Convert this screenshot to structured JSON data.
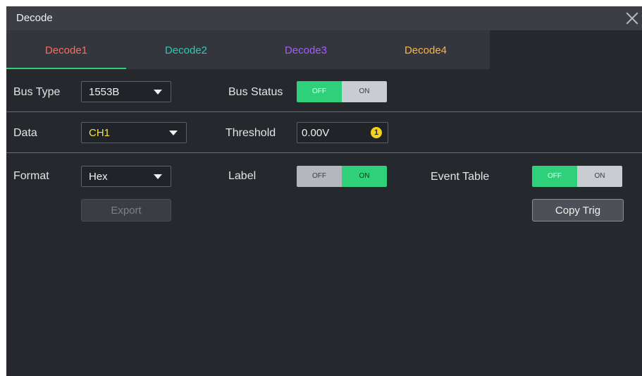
{
  "dialog": {
    "title": "Decode"
  },
  "tabs": [
    {
      "label": "Decode1",
      "color": "#ff6a5e"
    },
    {
      "label": "Decode2",
      "color": "#2ec9b3"
    },
    {
      "label": "Decode3",
      "color": "#a35cff"
    },
    {
      "label": "Decode4",
      "color": "#ffb347"
    }
  ],
  "bus_type": {
    "label": "Bus Type",
    "value": "1553B"
  },
  "bus_status": {
    "label": "Bus Status",
    "off": "OFF",
    "on": "ON",
    "state": "OFF"
  },
  "data": {
    "label": "Data",
    "value": "CH1",
    "value_color": "#f5e33a"
  },
  "threshold": {
    "label": "Threshold",
    "value": "0.00V",
    "knob": "1"
  },
  "format": {
    "label": "Format",
    "value": "Hex"
  },
  "label_toggle": {
    "label": "Label",
    "off": "OFF",
    "on": "ON",
    "state": "ON"
  },
  "event_table": {
    "label": "Event Table",
    "off": "OFF",
    "on": "ON",
    "state": "OFF"
  },
  "buttons": {
    "export": "Export",
    "copy_trig": "Copy Trig"
  },
  "accent": "#2ed07a"
}
